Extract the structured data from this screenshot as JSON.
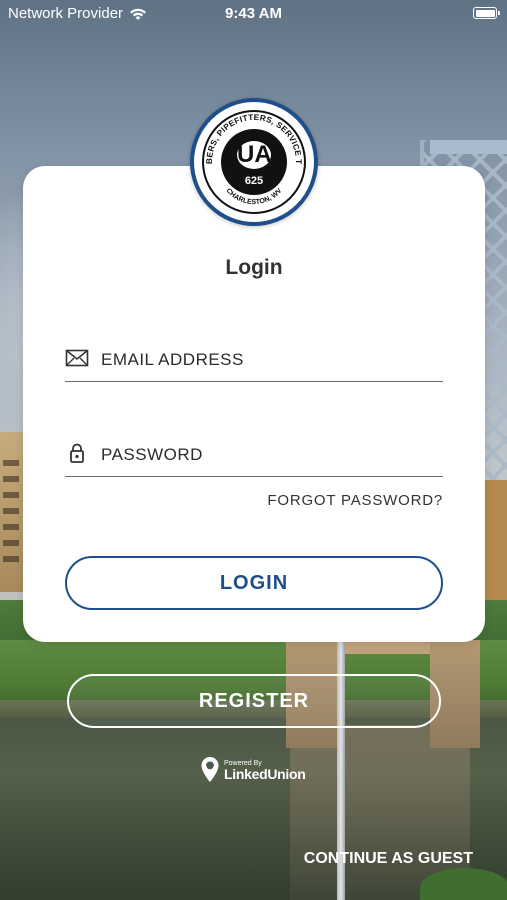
{
  "status_bar": {
    "carrier": "Network Provider",
    "time": "9:43 AM"
  },
  "logo": {
    "arc_text": "PLUMBERS, PIPEFITTERS, SERVICE TECHS",
    "bottom_text": "CHARLESTON, WV",
    "monogram": "UA",
    "number": "625"
  },
  "login": {
    "title": "Login",
    "email_placeholder": "EMAIL ADDRESS",
    "password_placeholder": "PASSWORD",
    "forgot_password": "FORGOT PASSWORD?",
    "login_button": "LOGIN"
  },
  "register_button": "REGISTER",
  "powered_by": {
    "label": "Powered By",
    "brand": "LinkedUnion"
  },
  "continue_guest": "CONTINUE AS GUEST",
  "colors": {
    "accent": "#1e4f8a",
    "card": "#ffffff"
  }
}
